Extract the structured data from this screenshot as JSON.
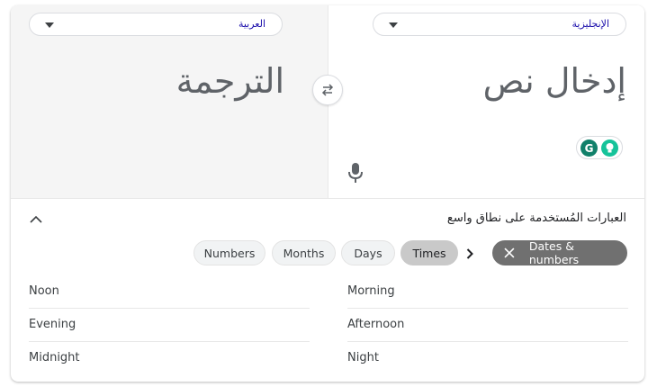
{
  "source_lang": {
    "label": "الإنجليزية"
  },
  "target_lang": {
    "label": "العربية"
  },
  "source_text": {
    "placeholder": "إدخال نص"
  },
  "target_text": {
    "placeholder": "الترجمة"
  },
  "phrasebook": {
    "title": "العبارات المُستخدمة على نطاق واسع",
    "filter_chip": "Dates & numbers",
    "chips": [
      "Numbers",
      "Months",
      "Days",
      "Times"
    ],
    "selected_chip": "Times",
    "left_column": [
      "Noon",
      "Evening",
      "Midnight"
    ],
    "right_column": [
      "Morning",
      "Afternoon",
      "Night"
    ]
  },
  "extensions": {
    "grammarly_letter": "G"
  },
  "colors": {
    "accent_link": "#1a0dab",
    "grammarly_green": "#15c39a",
    "selected_chip": "#c9c9c9",
    "filter_chip": "#707070"
  },
  "icons": [
    "swap-icon",
    "microphone-icon",
    "chevron-down-icon",
    "chevron-up-icon",
    "chevron-right-icon",
    "close-icon",
    "lightbulb-icon"
  ]
}
